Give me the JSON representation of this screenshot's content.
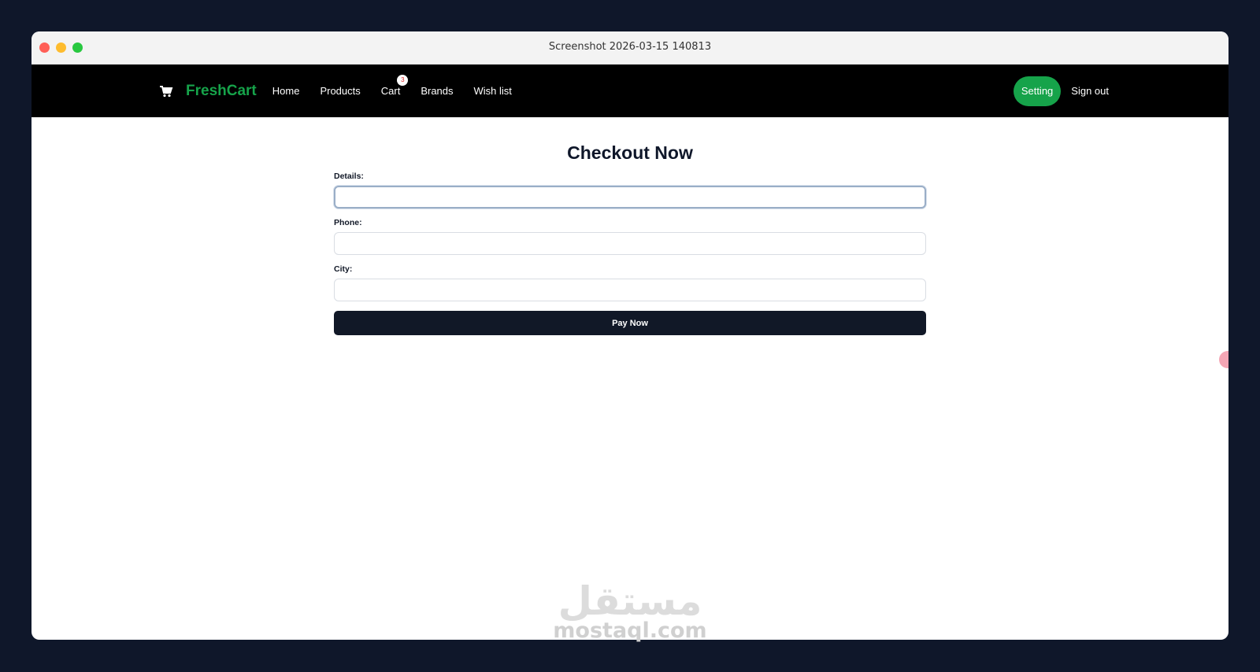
{
  "window": {
    "title": "Screenshot 2026-03-15 140813"
  },
  "navbar": {
    "brand": "FreshCart",
    "links": [
      {
        "label": "Home"
      },
      {
        "label": "Products"
      },
      {
        "label": "Cart",
        "badge": "3"
      },
      {
        "label": "Brands"
      },
      {
        "label": "Wish list"
      }
    ],
    "setting_label": "Setting",
    "signout_label": "Sign out"
  },
  "checkout": {
    "title": "Checkout Now",
    "fields": [
      {
        "label": "Details:",
        "value": ""
      },
      {
        "label": "Phone:",
        "value": ""
      },
      {
        "label": "City:",
        "value": ""
      }
    ],
    "submit_label": "Pay Now"
  },
  "watermark": {
    "arabic": "مستقل",
    "latin": "mostaql.com"
  },
  "colors": {
    "brand": "#16a34a",
    "navbar": "#000000",
    "button": "#111827",
    "background": "#0f172a"
  }
}
